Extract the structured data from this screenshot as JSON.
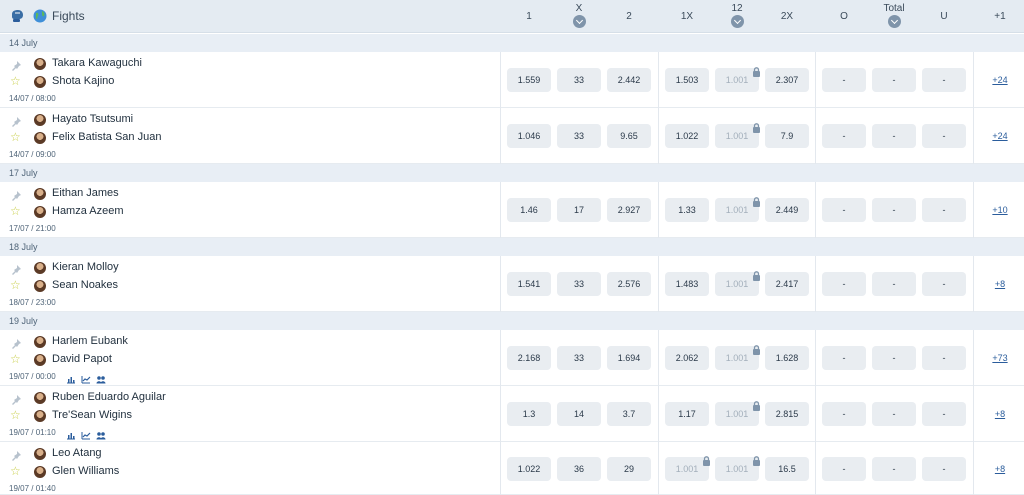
{
  "header": {
    "title": "Fights",
    "columns": [
      "1",
      "X",
      "2",
      "1X",
      "12",
      "2X",
      "O",
      "Total",
      "U",
      "+1"
    ]
  },
  "dates": [
    "14 July",
    "17 July",
    "18 July",
    "19 July"
  ],
  "matches": [
    {
      "fighter1": "Takara Kawaguchi",
      "fighter2": "Shota Kajino",
      "time": "14/07 / 08:00",
      "odds": [
        "1.559",
        "33",
        "2.442",
        "1.503",
        "1.001",
        "2.307",
        "-",
        "-",
        "-"
      ],
      "more": "+24"
    },
    {
      "fighter1": "Hayato Tsutsumi",
      "fighter2": "Felix Batista San Juan",
      "time": "14/07 / 09:00",
      "odds": [
        "1.046",
        "33",
        "9.65",
        "1.022",
        "1.001",
        "7.9",
        "-",
        "-",
        "-"
      ],
      "more": "+24"
    },
    {
      "fighter1": "Eithan James",
      "fighter2": "Hamza Azeem",
      "time": "17/07 / 21:00",
      "odds": [
        "1.46",
        "17",
        "2.927",
        "1.33",
        "1.001",
        "2.449",
        "-",
        "-",
        "-"
      ],
      "more": "+10"
    },
    {
      "fighter1": "Kieran Molloy",
      "fighter2": "Sean Noakes",
      "time": "18/07 / 23:00",
      "odds": [
        "1.541",
        "33",
        "2.576",
        "1.483",
        "1.001",
        "2.417",
        "-",
        "-",
        "-"
      ],
      "more": "+8"
    },
    {
      "fighter1": "Harlem Eubank",
      "fighter2": "David Papot",
      "time": "19/07 / 00:00",
      "odds": [
        "2.168",
        "33",
        "1.694",
        "2.062",
        "1.001",
        "1.628",
        "-",
        "-",
        "-"
      ],
      "more": "+73"
    },
    {
      "fighter1": "Ruben Eduardo Aguilar",
      "fighter2": "Tre'Sean Wigins",
      "time": "19/07 / 01:10",
      "odds": [
        "1.3",
        "14",
        "3.7",
        "1.17",
        "1.001",
        "2.815",
        "-",
        "-",
        "-"
      ],
      "more": "+8"
    },
    {
      "fighter1": "Leo Atang",
      "fighter2": "Glen Williams",
      "time": "19/07 / 01:40",
      "odds": [
        "1.022",
        "36",
        "29",
        "1.001",
        "1.001",
        "16.5",
        "-",
        "-",
        "-"
      ],
      "more": "+8"
    }
  ],
  "icons": {
    "sport": "boxing-glove-icon",
    "region": "globe-icon",
    "pin": "pin-icon",
    "favorite": "star-icon",
    "lock": "lock-icon",
    "stats": [
      "bar-chart-icon",
      "line-chart-icon",
      "h2h-icon"
    ]
  },
  "colors": {
    "header_bg": "#e4ebf2",
    "odd_bg": "#e9edf1",
    "link": "#2b5d9c",
    "star": "#c9cf4a"
  }
}
